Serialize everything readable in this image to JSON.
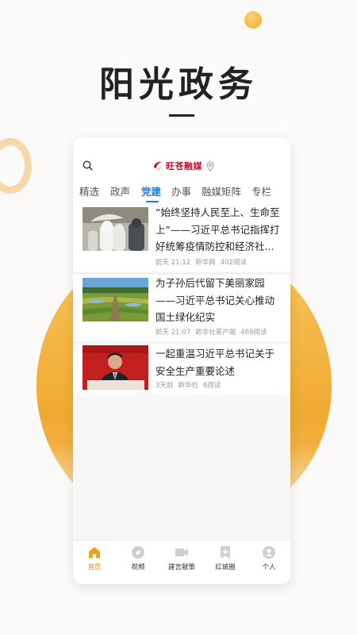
{
  "hero": {
    "title": "阳光政务"
  },
  "app": {
    "brand_name": "旺苍融媒",
    "icons": {
      "search": "search-icon",
      "location": "location-pin-icon",
      "logo": "brand-logo-icon"
    }
  },
  "tabs": [
    {
      "label": "精选",
      "active": false
    },
    {
      "label": "政声",
      "active": false
    },
    {
      "label": "党建",
      "active": true
    },
    {
      "label": "办事",
      "active": false
    },
    {
      "label": "融媒矩阵",
      "active": false
    },
    {
      "label": "专栏",
      "active": false
    }
  ],
  "news": [
    {
      "title": "“始终坚持人民至上、生命至上”——习近平总书记指挥打好统筹疫情防控和经济社...",
      "time": "前天 21:12",
      "source": "新华网",
      "reads": "402阅读",
      "image": "medical-workers-photo"
    },
    {
      "title": "为子孙后代留下美丽家园——习近平总书记关心推动国土绿化纪实",
      "time": "前天 21:07",
      "source": "新华社客户端",
      "reads": "469阅读",
      "image": "grassland-photo"
    },
    {
      "title": "一起重温习近平总书记关于安全生产重要论述",
      "time": "3天前",
      "source": "新华社",
      "reads": "6阅读",
      "image": "speaker-photo"
    }
  ],
  "bottom_nav": [
    {
      "label": "首页",
      "icon": "home-icon",
      "active": true
    },
    {
      "label": "视频",
      "icon": "video-icon",
      "active": false
    },
    {
      "label": "建言献策",
      "icon": "camera-icon",
      "active": false
    },
    {
      "label": "红城圈",
      "icon": "bookmark-star-icon",
      "active": false
    },
    {
      "label": "个人",
      "icon": "user-icon",
      "active": false
    }
  ],
  "colors": {
    "accent_blue": "#1f7fd6",
    "accent_orange": "#e8891c",
    "brand_red": "#c8102e"
  }
}
